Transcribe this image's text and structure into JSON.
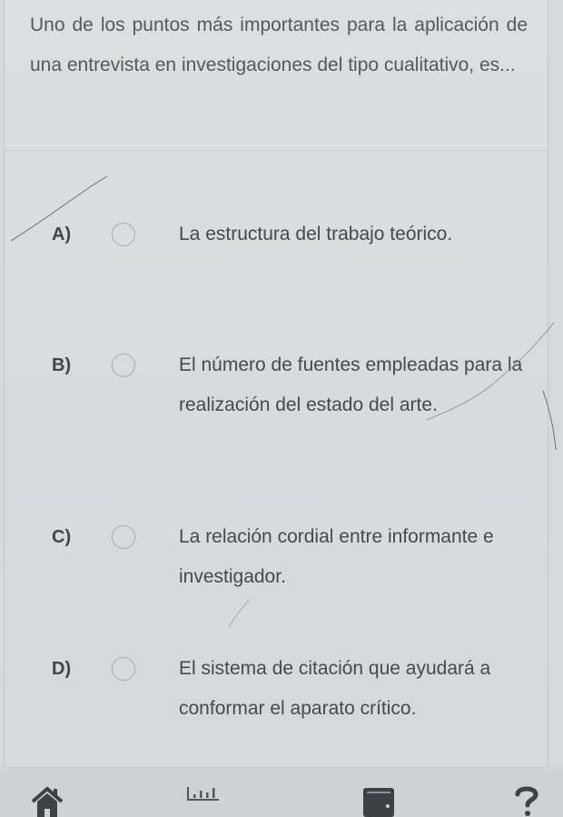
{
  "question": {
    "text": "Uno de los puntos más importantes para la aplicación de una entrevista en investigaciones del tipo cualitativo, es..."
  },
  "options": [
    {
      "letter": "A)",
      "text": "La estructura del trabajo teórico.",
      "selected": false
    },
    {
      "letter": "B)",
      "text": "El número de fuentes empleadas para la realización del estado del arte.",
      "selected": false
    },
    {
      "letter": "C)",
      "text": "La relación cordial entre informante e investigador.",
      "selected": false
    },
    {
      "letter": "D)",
      "text": "El sistema de citación que ayudará a conformar el aparato crítico.",
      "selected": false
    }
  ],
  "bottom_nav": {
    "items": [
      {
        "icon": "home-icon"
      },
      {
        "icon": "bar-chart-icon"
      },
      {
        "icon": "wallet-icon"
      },
      {
        "icon": "help-icon",
        "glyph": "?"
      }
    ]
  },
  "colors": {
    "background": "#d9dbde",
    "text": "#48484d",
    "icon": "#3f4045",
    "radio_border": "#a9abae"
  }
}
